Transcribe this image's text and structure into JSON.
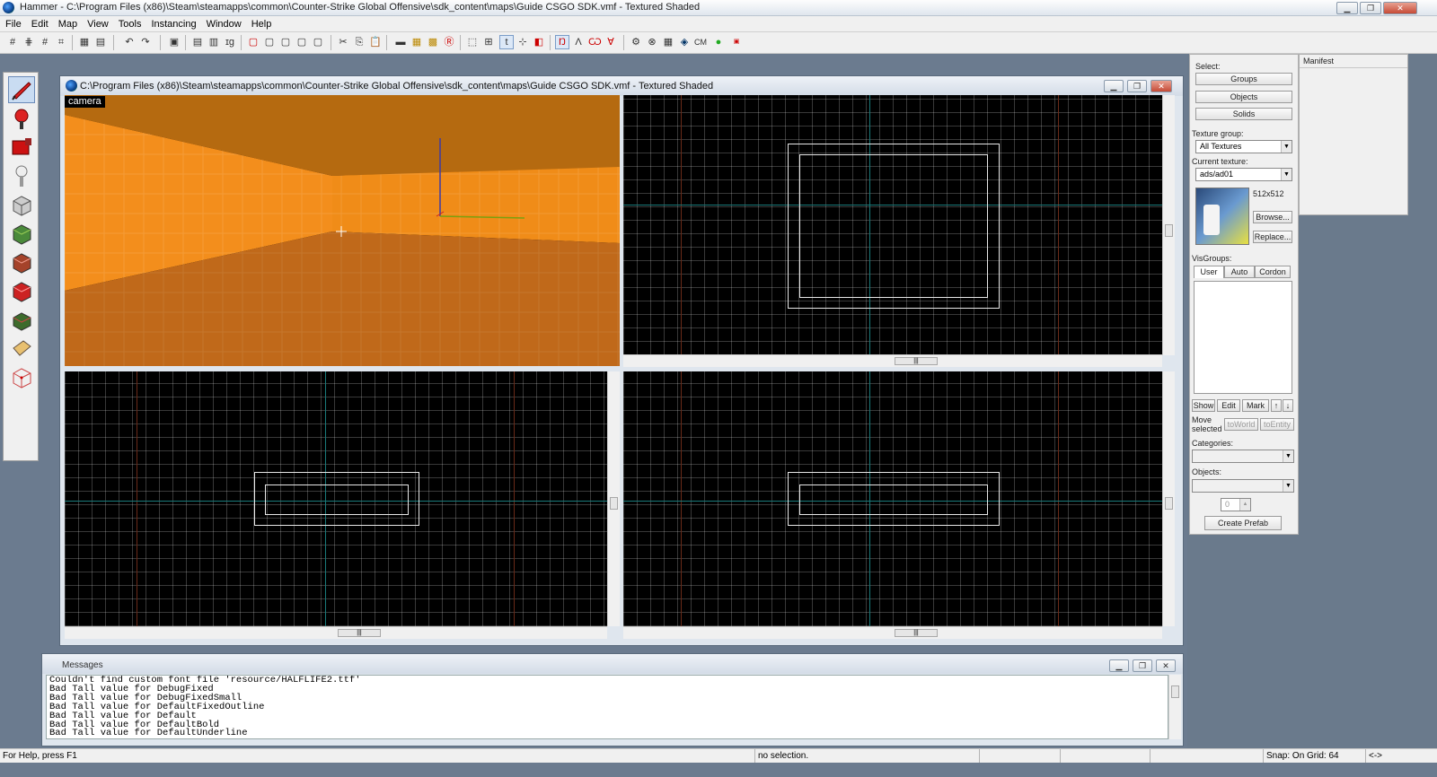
{
  "app_title": "Hammer - C:\\Program Files (x86)\\Steam\\steamapps\\common\\Counter-Strike Global Offensive\\sdk_content\\maps\\Guide CSGO SDK.vmf - Textured Shaded",
  "menu": [
    "File",
    "Edit",
    "Map",
    "View",
    "Tools",
    "Instancing",
    "Window",
    "Help"
  ],
  "toolbar": {
    "cm_label": "CM"
  },
  "map_window": {
    "title": "C:\\Program Files (x86)\\Steam\\steamapps\\common\\Counter-Strike Global Offensive\\sdk_content\\maps\\Guide CSGO SDK.vmf - Textured Shaded",
    "camera_label": "camera"
  },
  "right_panel": {
    "select_label": "Select:",
    "groups": "Groups",
    "objects": "Objects",
    "solids": "Solids",
    "texture_group_label": "Texture group:",
    "texture_group_value": "All Textures",
    "current_texture_label": "Current texture:",
    "current_texture_value": "ads/ad01",
    "texture_size": "512x512",
    "browse": "Browse...",
    "replace": "Replace...",
    "visgroups_label": "VisGroups:",
    "tab_user": "User",
    "tab_auto": "Auto",
    "tab_cordon": "Cordon",
    "show": "Show",
    "edit": "Edit",
    "mark": "Mark",
    "move_selected": "Move selected",
    "to_world": "toWorld",
    "to_entity": "toEntity",
    "categories_label": "Categories:",
    "objects_label": "Objects:",
    "spinner_value": "0",
    "create_prefab": "Create Prefab"
  },
  "manifest_label": "Manifest",
  "messages": {
    "title": "Messages",
    "lines": "Couldn't find custom font file 'resource/HALFLIFE2.ttf'\nBad Tall value for DebugFixed\nBad Tall value for DebugFixedSmall\nBad Tall value for DefaultFixedOutline\nBad Tall value for Default\nBad Tall value for DefaultBold\nBad Tall value for DefaultUnderline"
  },
  "status": {
    "help": "For Help, press F1",
    "selection": "no selection.",
    "snap": "Snap: On Grid: 64",
    "arrows": "<->"
  },
  "colors": {
    "wall_orange": "#f28a1a",
    "floor_orange": "#c26a12",
    "grid_axis_teal": "#1a7a7a",
    "grid_major_red": "#7a2a1a"
  }
}
